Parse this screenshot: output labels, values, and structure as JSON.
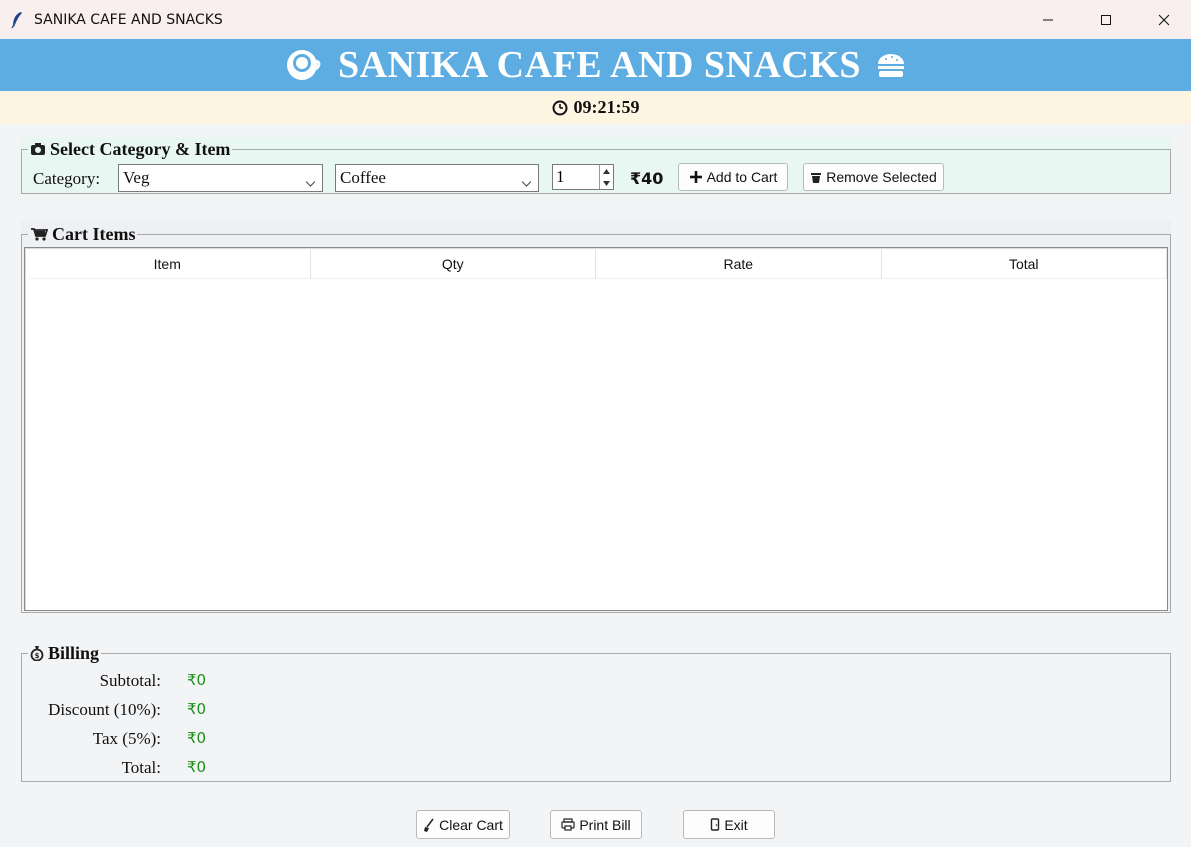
{
  "window": {
    "title": "SANIKA CAFE AND SNACKS"
  },
  "header": {
    "title": "SANIKA CAFE AND SNACKS",
    "time": "09:21:59"
  },
  "select_section": {
    "legend": "Select Category & Item",
    "category_label": "Category:",
    "category_value": "Veg",
    "item_value": "Coffee",
    "quantity": "1",
    "price": "₹40",
    "add_button": "Add to Cart",
    "remove_button": "Remove Selected"
  },
  "cart": {
    "legend": "Cart Items",
    "columns": [
      "Item",
      "Qty",
      "Rate",
      "Total"
    ],
    "rows": []
  },
  "billing": {
    "legend": "Billing",
    "rows": [
      {
        "label": "Subtotal:",
        "value": "₹0"
      },
      {
        "label": "Discount (10%):",
        "value": "₹0"
      },
      {
        "label": "Tax (5%):",
        "value": "₹0"
      },
      {
        "label": "Total:",
        "value": "₹0"
      }
    ]
  },
  "actions": {
    "clear": "Clear Cart",
    "print": "Print Bill",
    "exit": "Exit"
  },
  "colors": {
    "banner": "#5dade2",
    "clock_bar": "#fdf4e2",
    "select_bg": "#e9f7f2",
    "billing_value": "#1a8f1a"
  }
}
